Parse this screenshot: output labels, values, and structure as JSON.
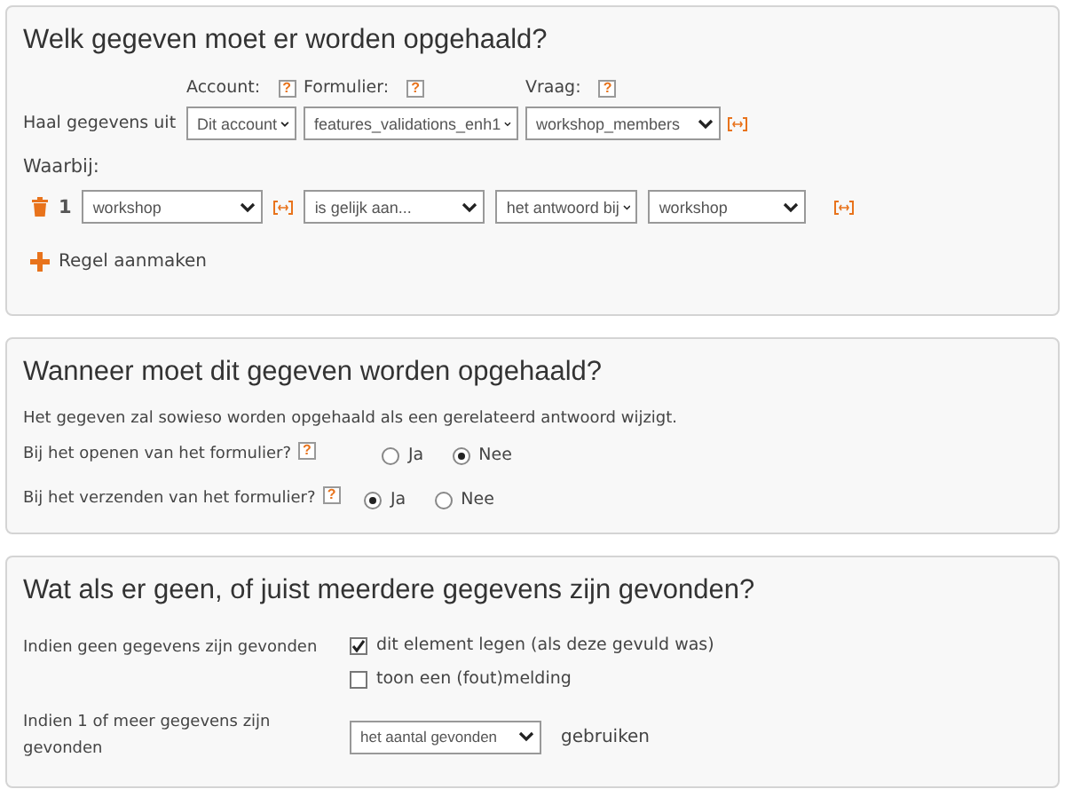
{
  "source_section": {
    "title": "Welk gegeven moet er worden opgehaald?",
    "columns": [
      {
        "label": "Account:",
        "help": "?"
      },
      {
        "label": "Formulier:",
        "help": "?"
      },
      {
        "label": "Vraag:",
        "help": "?"
      }
    ],
    "source_label": "Haal gegevens uit",
    "source_selects": [
      "Dit account",
      "features_validations_enh1",
      "workshop_members"
    ],
    "where_label": "Waarbij:",
    "conditions": [
      {
        "number": "1",
        "field": "workshop",
        "operator": "is gelijk aan...",
        "value_type": "het antwoord bij",
        "value": "workshop"
      }
    ],
    "add_label": "Regel aanmaken"
  },
  "timing_section": {
    "title": "Wanneer moet dit gegeven worden opgehaald?",
    "note": "Het gegeven zal sowieso worden opgehaald als een gerelateerd antwoord wijzigt.",
    "questions": [
      {
        "label": "Bij het openen van het formulier?",
        "help": "?",
        "options": [
          {
            "label": "Ja",
            "selected": false
          },
          {
            "label": "Nee",
            "selected": true
          }
        ]
      },
      {
        "label": "Bij het verzenden van het formulier?",
        "help": "?",
        "options": [
          {
            "label": "Ja",
            "selected": true
          },
          {
            "label": "Nee",
            "selected": false
          }
        ]
      }
    ]
  },
  "results_section": {
    "title": "Wat als er geen, of juist meerdere gegevens zijn gevonden?",
    "none_label": "Indien geen gegevens zijn gevonden",
    "none_options": [
      {
        "label": "dit element legen (als deze gevuld was)",
        "checked": true
      },
      {
        "label": "toon een (fout)melding",
        "checked": false
      }
    ],
    "many_label": "Indien 1 of meer gegevens zijn gevonden",
    "many_select": "het aantal gevonden",
    "many_suffix": "gebruiken"
  }
}
